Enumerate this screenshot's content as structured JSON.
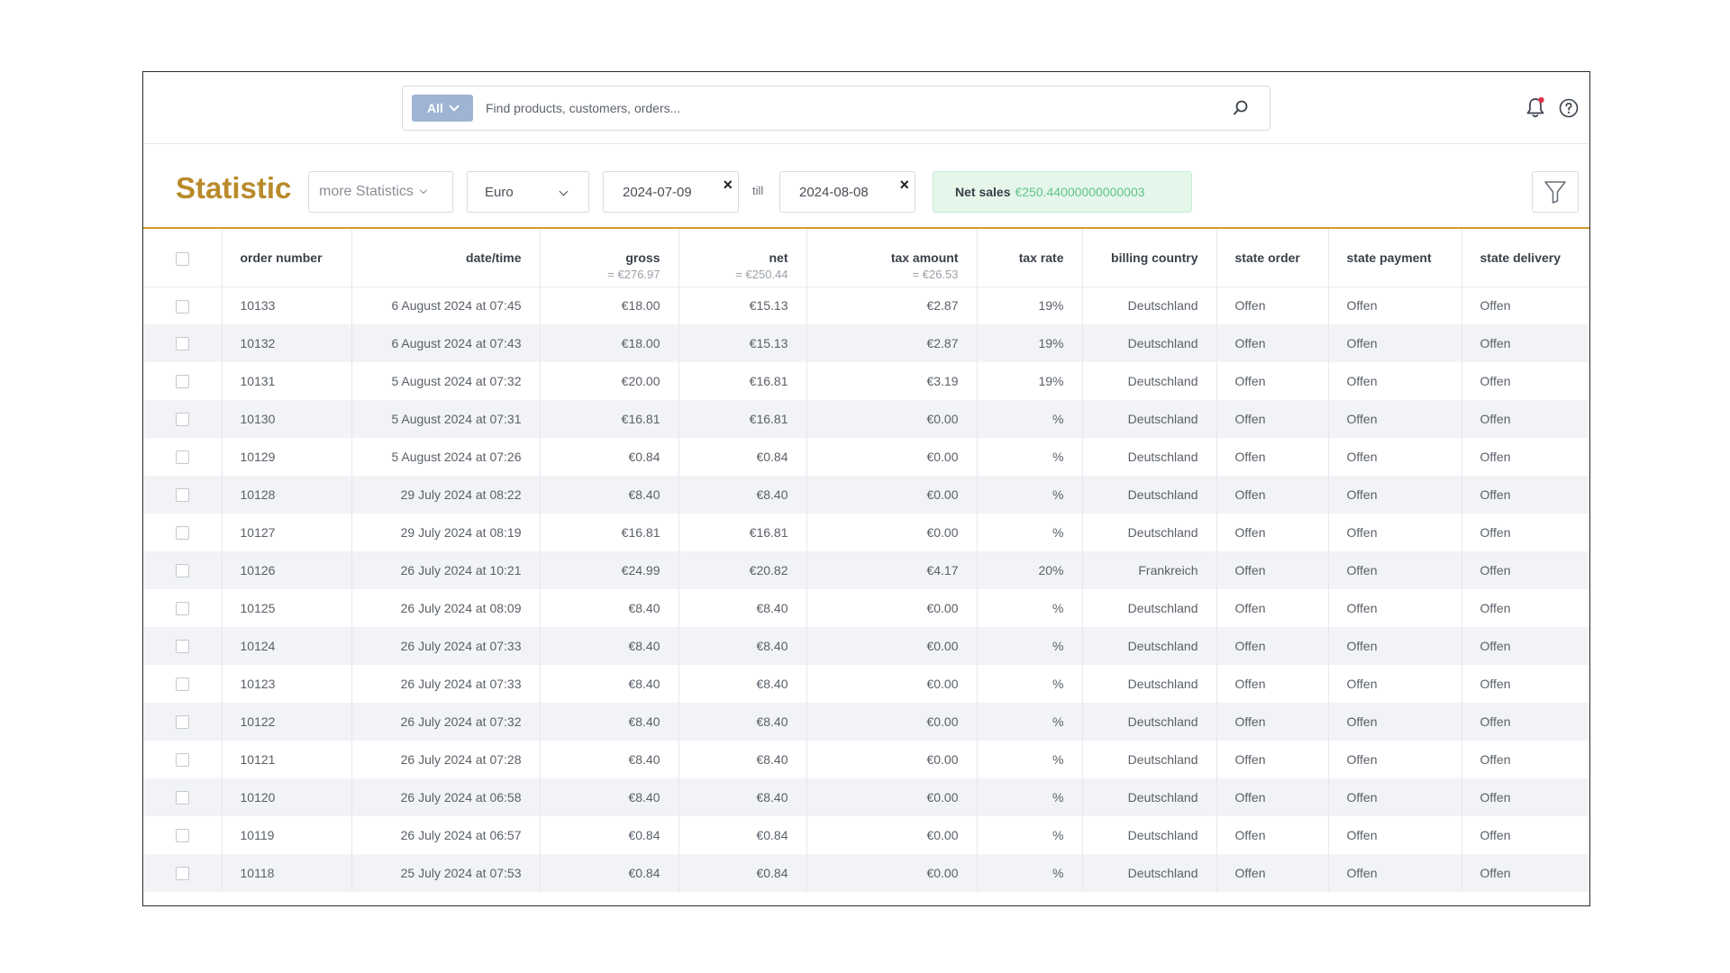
{
  "search": {
    "scope_label": "All",
    "placeholder": "Find products, customers, orders...",
    "value": ""
  },
  "filters": {
    "page_title": "Statistic",
    "more_statistics_label": "more Statistics",
    "currency": "Euro",
    "date_from": "2024-07-09",
    "till_label": "till",
    "date_to": "2024-08-08",
    "clear_glyph": "×",
    "net_sales_label": "Net sales",
    "net_sales_value": "€250.44000000000003"
  },
  "icons": {
    "search": "search-icon",
    "bell": "bell-icon",
    "help": "help-icon",
    "filter": "filter-icon"
  },
  "colors": {
    "accent": "#b98a2a",
    "accent_line": "#d29b2c",
    "scope_bg": "#9fb4d3",
    "net_sales_bg": "#e5f6ea",
    "net_sales_value": "#5fc48a",
    "notification_dot": "#e0334a"
  },
  "table": {
    "headers": {
      "order_number": "order number",
      "date_time": "date/time",
      "gross": "gross",
      "gross_total": "= €276.97",
      "net": "net",
      "net_total": "= €250.44",
      "tax_amount": "tax amount",
      "tax_amount_total": "= €26.53",
      "tax_rate": "tax rate",
      "billing_country": "billing country",
      "state_order": "state order",
      "state_payment": "state payment",
      "state_delivery": "state delivery"
    },
    "rows": [
      {
        "order": "10133",
        "date": "6 August 2024 at 07:45",
        "gross": "€18.00",
        "net": "€15.13",
        "tax": "€2.87",
        "rate": "19%",
        "country": "Deutschland",
        "state_order": "Offen",
        "state_payment": "Offen",
        "state_delivery": "Offen"
      },
      {
        "order": "10132",
        "date": "6 August 2024 at 07:43",
        "gross": "€18.00",
        "net": "€15.13",
        "tax": "€2.87",
        "rate": "19%",
        "country": "Deutschland",
        "state_order": "Offen",
        "state_payment": "Offen",
        "state_delivery": "Offen"
      },
      {
        "order": "10131",
        "date": "5 August 2024 at 07:32",
        "gross": "€20.00",
        "net": "€16.81",
        "tax": "€3.19",
        "rate": "19%",
        "country": "Deutschland",
        "state_order": "Offen",
        "state_payment": "Offen",
        "state_delivery": "Offen"
      },
      {
        "order": "10130",
        "date": "5 August 2024 at 07:31",
        "gross": "€16.81",
        "net": "€16.81",
        "tax": "€0.00",
        "rate": "%",
        "country": "Deutschland",
        "state_order": "Offen",
        "state_payment": "Offen",
        "state_delivery": "Offen"
      },
      {
        "order": "10129",
        "date": "5 August 2024 at 07:26",
        "gross": "€0.84",
        "net": "€0.84",
        "tax": "€0.00",
        "rate": "%",
        "country": "Deutschland",
        "state_order": "Offen",
        "state_payment": "Offen",
        "state_delivery": "Offen"
      },
      {
        "order": "10128",
        "date": "29 July 2024 at 08:22",
        "gross": "€8.40",
        "net": "€8.40",
        "tax": "€0.00",
        "rate": "%",
        "country": "Deutschland",
        "state_order": "Offen",
        "state_payment": "Offen",
        "state_delivery": "Offen"
      },
      {
        "order": "10127",
        "date": "29 July 2024 at 08:19",
        "gross": "€16.81",
        "net": "€16.81",
        "tax": "€0.00",
        "rate": "%",
        "country": "Deutschland",
        "state_order": "Offen",
        "state_payment": "Offen",
        "state_delivery": "Offen"
      },
      {
        "order": "10126",
        "date": "26 July 2024 at 10:21",
        "gross": "€24.99",
        "net": "€20.82",
        "tax": "€4.17",
        "rate": "20%",
        "country": "Frankreich",
        "state_order": "Offen",
        "state_payment": "Offen",
        "state_delivery": "Offen"
      },
      {
        "order": "10125",
        "date": "26 July 2024 at 08:09",
        "gross": "€8.40",
        "net": "€8.40",
        "tax": "€0.00",
        "rate": "%",
        "country": "Deutschland",
        "state_order": "Offen",
        "state_payment": "Offen",
        "state_delivery": "Offen"
      },
      {
        "order": "10124",
        "date": "26 July 2024 at 07:33",
        "gross": "€8.40",
        "net": "€8.40",
        "tax": "€0.00",
        "rate": "%",
        "country": "Deutschland",
        "state_order": "Offen",
        "state_payment": "Offen",
        "state_delivery": "Offen"
      },
      {
        "order": "10123",
        "date": "26 July 2024 at 07:33",
        "gross": "€8.40",
        "net": "€8.40",
        "tax": "€0.00",
        "rate": "%",
        "country": "Deutschland",
        "state_order": "Offen",
        "state_payment": "Offen",
        "state_delivery": "Offen"
      },
      {
        "order": "10122",
        "date": "26 July 2024 at 07:32",
        "gross": "€8.40",
        "net": "€8.40",
        "tax": "€0.00",
        "rate": "%",
        "country": "Deutschland",
        "state_order": "Offen",
        "state_payment": "Offen",
        "state_delivery": "Offen"
      },
      {
        "order": "10121",
        "date": "26 July 2024 at 07:28",
        "gross": "€8.40",
        "net": "€8.40",
        "tax": "€0.00",
        "rate": "%",
        "country": "Deutschland",
        "state_order": "Offen",
        "state_payment": "Offen",
        "state_delivery": "Offen"
      },
      {
        "order": "10120",
        "date": "26 July 2024 at 06:58",
        "gross": "€8.40",
        "net": "€8.40",
        "tax": "€0.00",
        "rate": "%",
        "country": "Deutschland",
        "state_order": "Offen",
        "state_payment": "Offen",
        "state_delivery": "Offen"
      },
      {
        "order": "10119",
        "date": "26 July 2024 at 06:57",
        "gross": "€0.84",
        "net": "€0.84",
        "tax": "€0.00",
        "rate": "%",
        "country": "Deutschland",
        "state_order": "Offen",
        "state_payment": "Offen",
        "state_delivery": "Offen"
      },
      {
        "order": "10118",
        "date": "25 July 2024 at 07:53",
        "gross": "€0.84",
        "net": "€0.84",
        "tax": "€0.00",
        "rate": "%",
        "country": "Deutschland",
        "state_order": "Offen",
        "state_payment": "Offen",
        "state_delivery": "Offen"
      }
    ]
  }
}
